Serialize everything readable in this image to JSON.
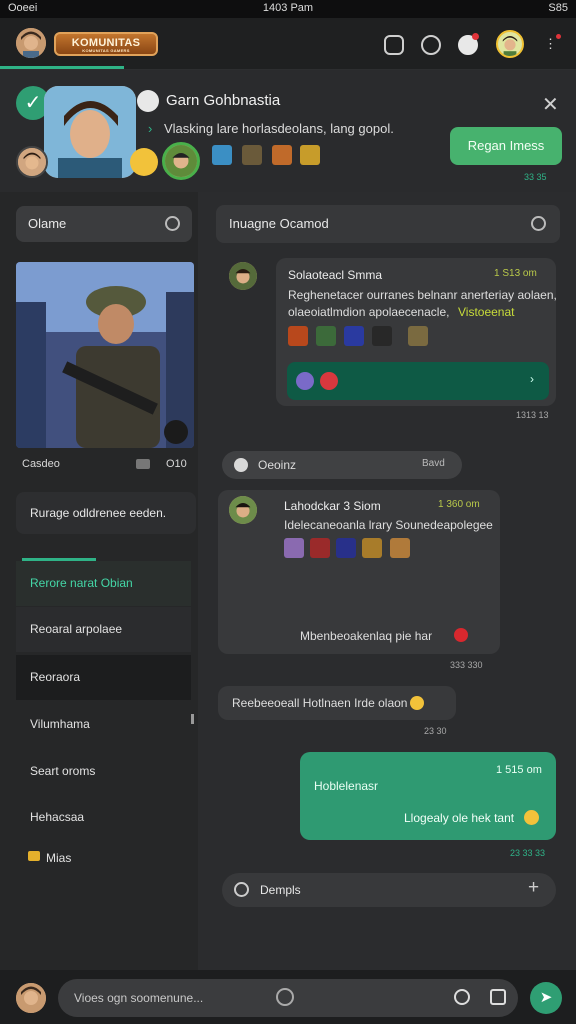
{
  "status_bar": {
    "carrier": "Ooeei",
    "time": "1403 Pam",
    "battery": "S85"
  },
  "top_nav": {
    "brand": "KOMUNITAS",
    "brand_tagline": "KOMUNITAS GAMERS"
  },
  "banner": {
    "title": "Garn Gohbnastia",
    "subtitle": "Vlasking lare horlasdeolans, lang gopol.",
    "cta_label": "Regan Imess",
    "cta_time": "33 35"
  },
  "left": {
    "search_placeholder": "Olame",
    "hero_caption": "Casdeo",
    "hero_count": "O10",
    "quote": "Rurage odldrenee eeden.",
    "menu": [
      "Rerore narat Obian",
      "Reoaral arpolaee",
      "Reoraora",
      "Vilumhama",
      "Seart oroms",
      "Hehacsaa",
      "Mias"
    ]
  },
  "right": {
    "search_placeholder": "Inuagne Ocamod",
    "msg1": {
      "name": "Solaoteacl Smma",
      "time": "1 S13 om",
      "text1": "Reghenetacer ourranes belnanr anerteriay aolaen,",
      "text2": "olaeoiatlmdion apolaecenacle,",
      "highlight": "Vistoeenat",
      "meta": "1313 13"
    },
    "system": {
      "label": "Oeoinz",
      "right": "Bavd"
    },
    "msg2": {
      "name": "Lahodckar 3 Siom",
      "time": "1 360 om",
      "text1": "Idelecaneoanla lrary Sounedeapolegee",
      "text2": "Mbenbeoakenlaq pie har",
      "meta": "333 330"
    },
    "msg3": {
      "text": "Reebeeoeall Hotlnaen Irde olaon",
      "meta": "23 30"
    },
    "out": {
      "title": "Hoblelenasr",
      "time": "1 515 om",
      "text": "Llogealy ole hek tant",
      "meta": "23 33 33"
    },
    "compose": "Dempls"
  },
  "bottom": {
    "placeholder": "Vioes ogn soomenune..."
  }
}
